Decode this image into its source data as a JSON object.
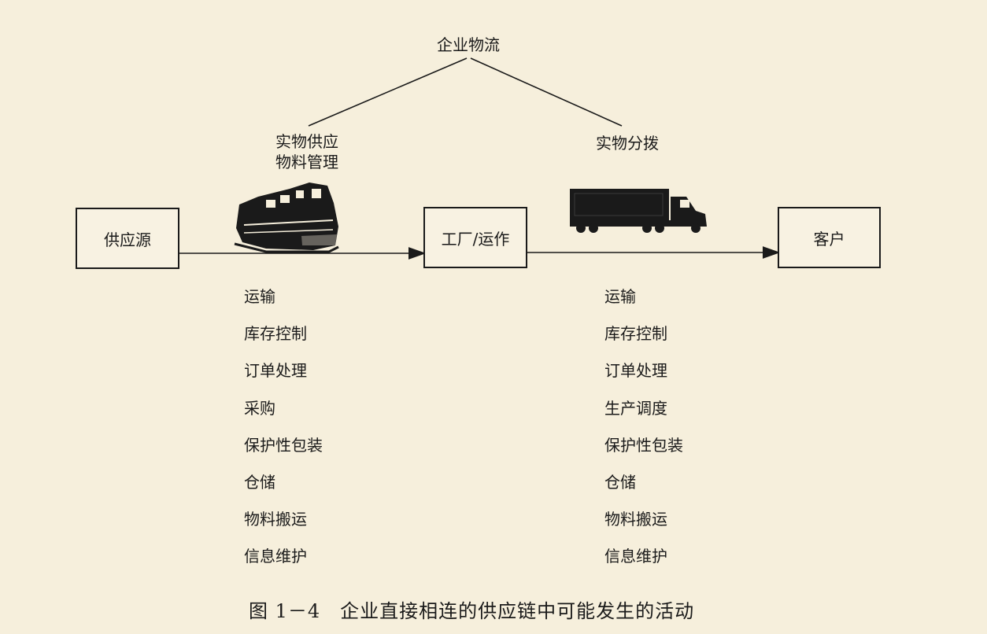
{
  "diagram": {
    "top_label": "企业物流",
    "left_branch_label": [
      "实物供应",
      "物料管理"
    ],
    "right_branch_label": "实物分拨",
    "nodes": {
      "supplier": "供应源",
      "factory": "工厂/运作",
      "customer": "客户"
    },
    "left_activities": [
      "运输",
      "库存控制",
      "订单处理",
      "采购",
      "保护性包装",
      "仓储",
      "物料搬运",
      "信息维护"
    ],
    "right_activities": [
      "运输",
      "库存控制",
      "订单处理",
      "生产调度",
      "保护性包装",
      "仓储",
      "物料搬运",
      "信息维护"
    ],
    "icons": {
      "left": "train-icon",
      "right": "truck-icon"
    }
  },
  "caption": "图 1－4　企业直接相连的供应链中可能发生的活动"
}
